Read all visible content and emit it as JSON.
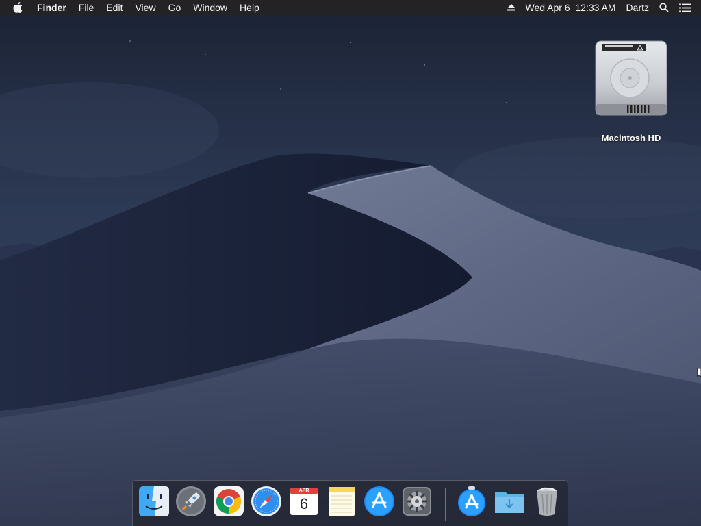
{
  "menubar": {
    "app_name": "Finder",
    "items": [
      "File",
      "Edit",
      "View",
      "Go",
      "Window",
      "Help"
    ],
    "clock": "Wed Apr 6  12:33 AM",
    "user": "Dartz",
    "icons": [
      "apple-icon",
      "eject-icon",
      "spotlight-search-icon",
      "notification-center-icon"
    ]
  },
  "desktop": {
    "icons": [
      {
        "label": "Macintosh HD",
        "icon": "hard-drive-icon"
      }
    ]
  },
  "dock": {
    "items": [
      {
        "name": "Finder",
        "icon": "finder-icon",
        "running": true
      },
      {
        "name": "Launchpad",
        "icon": "launchpad-icon",
        "running": false
      },
      {
        "name": "Google Chrome",
        "icon": "chrome-icon",
        "running": false
      },
      {
        "name": "Safari",
        "icon": "safari-icon",
        "running": false
      },
      {
        "name": "Calendar",
        "icon": "calendar-icon",
        "running": false,
        "month": "APR",
        "day": "6"
      },
      {
        "name": "Notes",
        "icon": "notes-icon",
        "running": false
      },
      {
        "name": "App Store",
        "icon": "app-store-icon",
        "running": false
      },
      {
        "name": "System Preferences",
        "icon": "system-preferences-icon",
        "running": false
      },
      {
        "name": "Applications",
        "icon": "applications-folder-icon",
        "running": false
      },
      {
        "name": "Downloads",
        "icon": "downloads-folder-icon",
        "running": false
      },
      {
        "name": "Trash",
        "icon": "trash-icon",
        "running": false
      }
    ]
  },
  "colors": {
    "menubar_bg": "#232325",
    "sky_top": "#1d2638",
    "dune_light": "#8d97ad",
    "dune_dark": "#1a2238"
  }
}
